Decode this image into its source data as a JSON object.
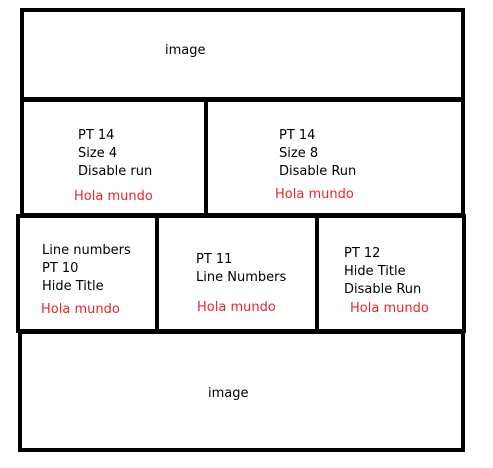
{
  "top_image": {
    "label": "image"
  },
  "row1": {
    "left": {
      "lines": [
        "PT 14",
        "Size 4",
        "Disable run"
      ],
      "sample": "Hola mundo"
    },
    "right": {
      "lines": [
        "PT 14",
        "Size 8",
        "Disable Run"
      ],
      "sample": "Hola mundo"
    }
  },
  "row2": {
    "left": {
      "lines": [
        "Line numbers",
        "PT 10",
        "Hide Title"
      ],
      "sample": "Hola mundo"
    },
    "middle": {
      "lines": [
        "PT 11",
        "Line Numbers"
      ],
      "sample": "Hola mundo"
    },
    "right": {
      "lines": [
        "PT 12",
        "Hide Title",
        "Disable Run"
      ],
      "sample": "Hola mundo"
    }
  },
  "bottom_image": {
    "label": "image"
  },
  "colors": {
    "border": "#000000",
    "sample_text": "#e8262e"
  }
}
